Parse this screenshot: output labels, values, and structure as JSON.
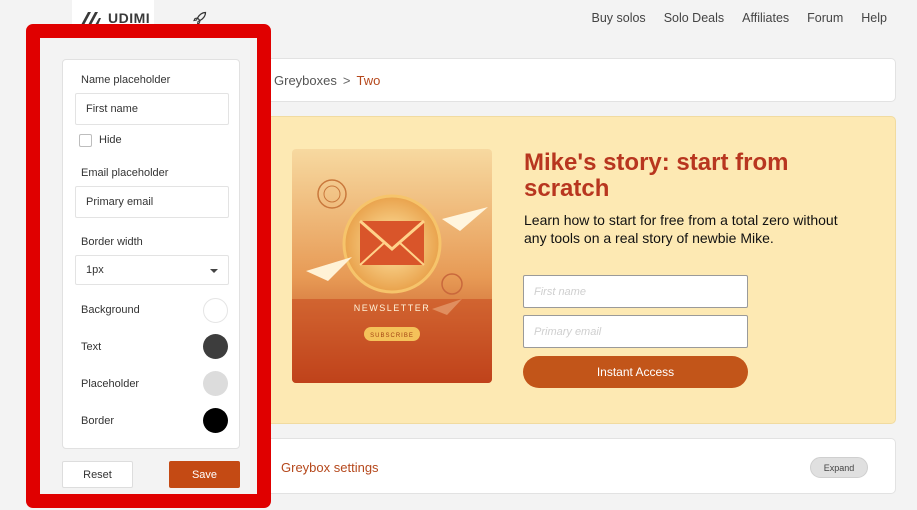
{
  "nav": {
    "logo_text": "UDIMI",
    "links": [
      "Buy solos",
      "Solo Deals",
      "Affiliates",
      "Forum",
      "Help"
    ]
  },
  "breadcrumb": {
    "parent": "Greyboxes",
    "separator": ">",
    "current": "Two"
  },
  "promo": {
    "title": "Mike's story: start from scratch",
    "description": "Learn how to start for free from a total zero without any tools on a real story of newbie Mike.",
    "first_name_placeholder": "First name",
    "email_placeholder": "Primary email",
    "button_label": "Instant Access",
    "image_banner_text": "NEWSLETTER",
    "image_button_text": "SUBSCRIBE",
    "background_color": "#fde9b3",
    "title_color": "#b8361f",
    "button_color": "#c25519"
  },
  "settings": {
    "title": "Greybox settings",
    "expand_label": "Expand"
  },
  "panel": {
    "name_placeholder_label": "Name placeholder",
    "name_placeholder_value": "First name",
    "hide_label": "Hide",
    "email_placeholder_label": "Email placeholder",
    "email_placeholder_value": "Primary email",
    "border_width_label": "Border width",
    "border_width_value": "1px",
    "colors": [
      {
        "label": "Background",
        "color": "#ffffff"
      },
      {
        "label": "Text",
        "color": "#3d3d3d"
      },
      {
        "label": "Placeholder",
        "color": "#dcdcdc"
      },
      {
        "label": "Border",
        "color": "#000000"
      }
    ],
    "reset_label": "Reset",
    "save_label": "Save",
    "highlight_color": "#e00000"
  }
}
